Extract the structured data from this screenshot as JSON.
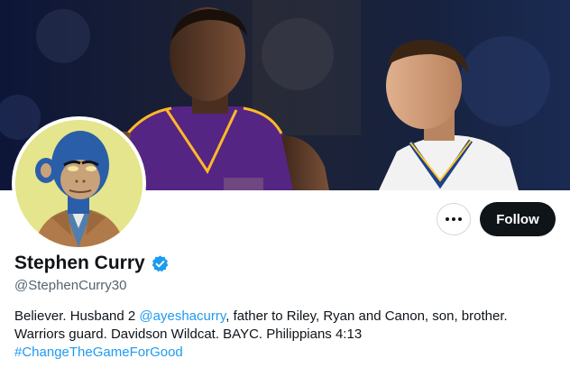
{
  "profile": {
    "display_name": "Stephen Curry",
    "handle": "@StephenCurry30",
    "verified": true,
    "bio": {
      "line1_prefix": "Believer. Husband 2 ",
      "mention": "@ayeshacurry",
      "line1_suffix": ", father to Riley, Ryan and Canon, son, brother.",
      "line2": "Warriors guard. Davidson Wildcat. BAYC. Philippians 4:13",
      "hashtag": "#ChangeTheGameForGood"
    }
  },
  "actions": {
    "follow_label": "Follow",
    "more_icon": "more-horizontal-icon"
  },
  "colors": {
    "link": "#1d9bf0",
    "follow_bg": "#0f1419",
    "verified": "#1d9bf0",
    "handle": "#536471",
    "avatar_bg": "#e4e58c"
  },
  "banner": {
    "alt": "Banner photo of two basketball players in Lakers and Warriors jerseys"
  },
  "avatar": {
    "alt": "Bored Ape avatar with blue fur in a tan suit"
  }
}
